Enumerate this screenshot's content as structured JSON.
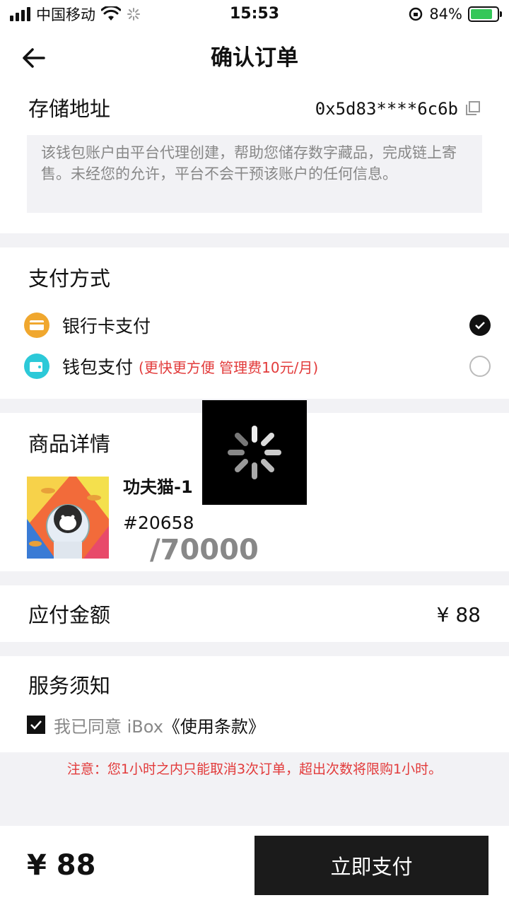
{
  "status_bar": {
    "carrier": "中国移动",
    "time": "15:53",
    "battery": "84%",
    "battery_level": 0.84
  },
  "nav": {
    "title": "确认订单"
  },
  "wallet": {
    "label": "存储地址",
    "address": "0x5d83****6c6b",
    "note": "该钱包账户由平台代理创建，帮助您储存数字藏品，完成链上寄售。未经您的允许，平台不会干预该账户的任何信息。"
  },
  "payment": {
    "title": "支付方式",
    "options": [
      {
        "label": "银行卡支付",
        "hint": "",
        "selected": true,
        "icon": "bank-card-icon",
        "color": "#f0a72e"
      },
      {
        "label": "钱包支付",
        "hint": "(更快更方便 管理费10元/月)",
        "selected": false,
        "icon": "wallet-icon",
        "color": "#2cc9d8"
      }
    ]
  },
  "product": {
    "title": "商品详情",
    "name": "功夫猫-1",
    "serial": "#20658",
    "total": "/70000"
  },
  "amount": {
    "label": "应付金额",
    "value": "¥ 88"
  },
  "service": {
    "title": "服务须知",
    "agree_text": "我已同意 iBox",
    "terms_link": "《使用条款》",
    "checked": true
  },
  "notice": "注意：您1小时之内只能取消3次订单，超出次数将限购1小时。",
  "footer": {
    "total": "¥ 88",
    "pay_button": "立即支付"
  },
  "colors": {
    "accent": "#1b1b1b",
    "warning": "#e23a3a",
    "muted": "#888888",
    "section_bg": "#f2f2f5"
  }
}
